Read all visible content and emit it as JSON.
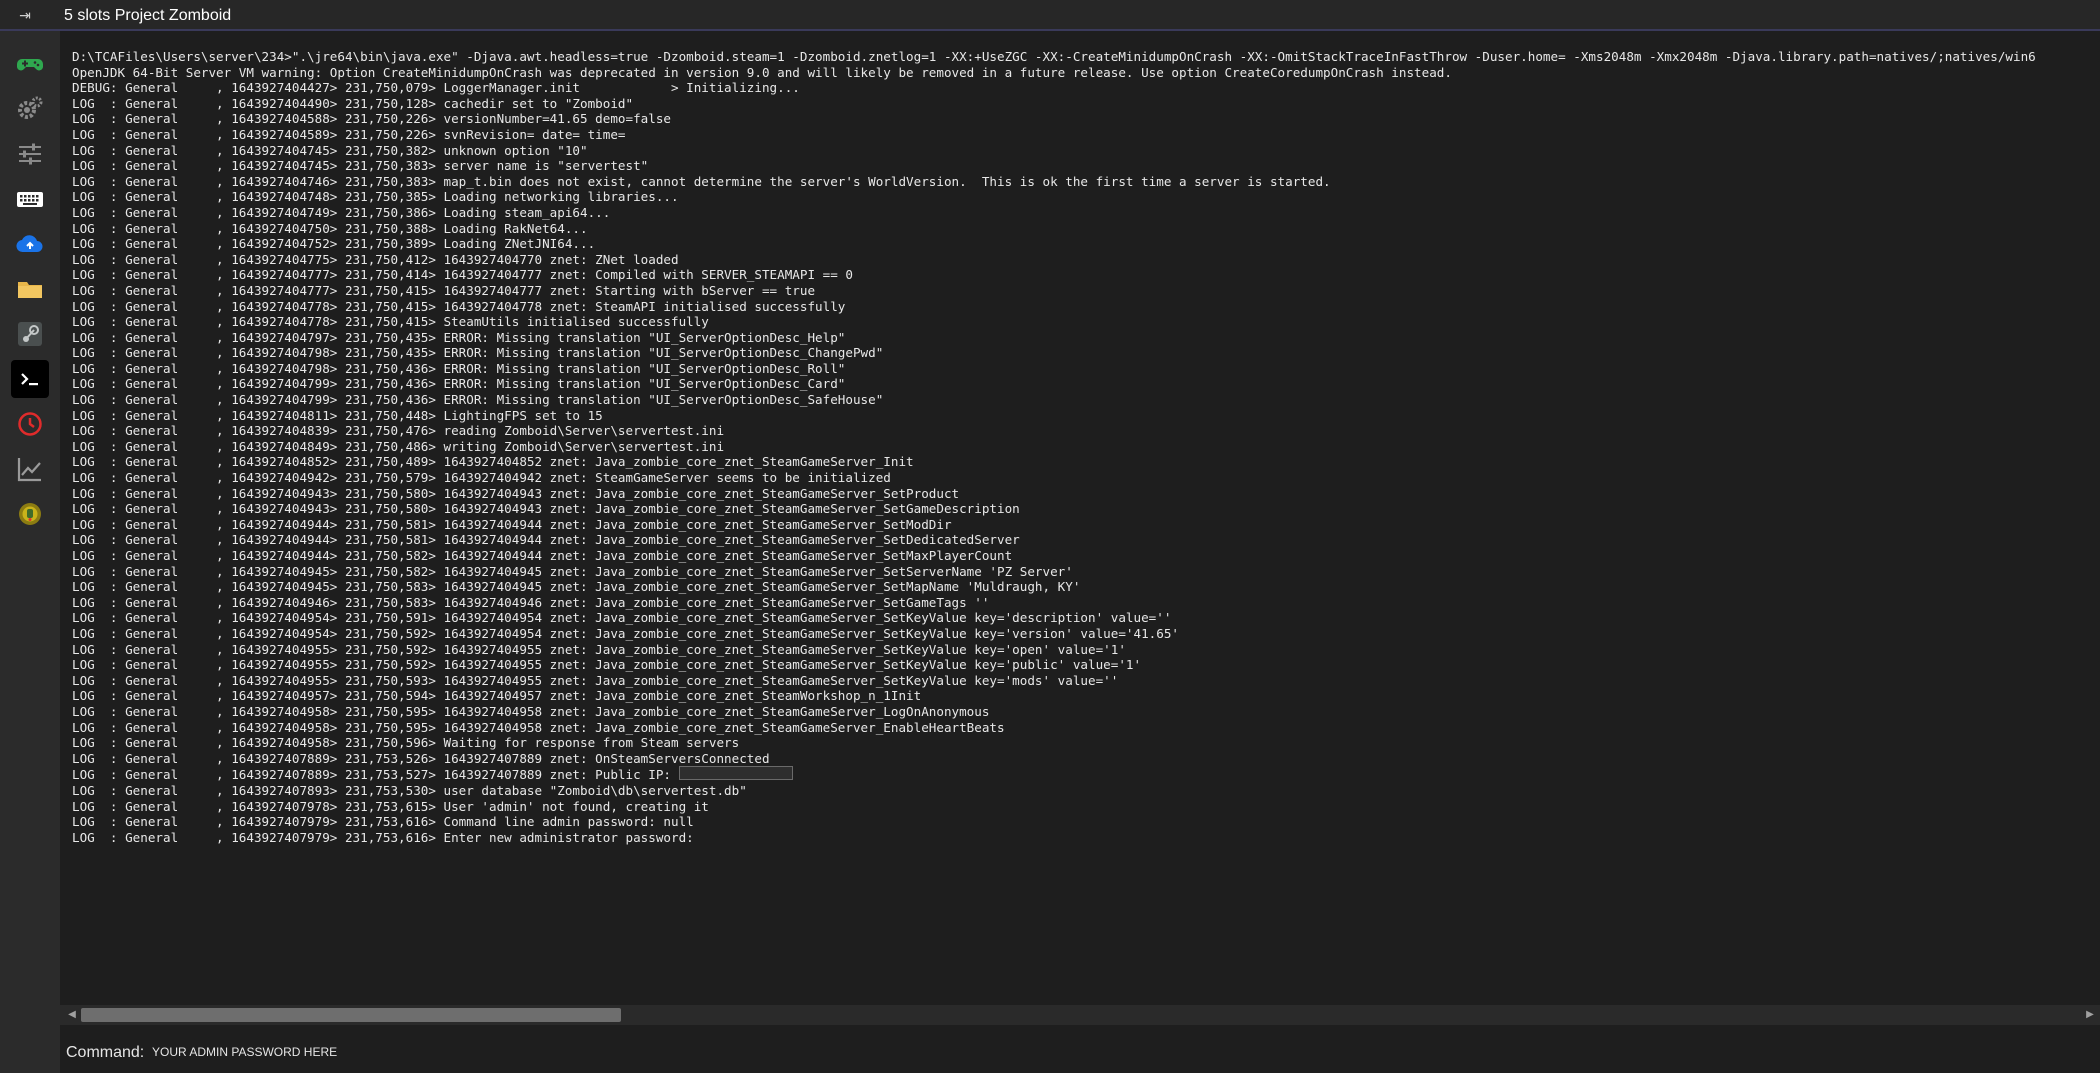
{
  "window": {
    "title": "5 slots Project Zomboid",
    "pin_glyph": "⇥"
  },
  "sidebar": {
    "items": [
      {
        "icon": "gamepad-icon",
        "color": "#2fa84f"
      },
      {
        "icon": "gears-icon",
        "color": "#8a8a8a"
      },
      {
        "icon": "sliders-icon",
        "color": "#8a8a8a"
      },
      {
        "icon": "keyboard-icon",
        "color": "#ffffff"
      },
      {
        "icon": "cloud-upload-icon",
        "color": "#1a73e8"
      },
      {
        "icon": "folder-icon",
        "color": "#e8b64a"
      },
      {
        "icon": "steam-icon",
        "color": "#9aa0a0"
      },
      {
        "icon": "terminal-icon",
        "color": "#ffffff",
        "active": true
      },
      {
        "icon": "clock-icon",
        "color": "#e02b2b"
      },
      {
        "icon": "chart-icon",
        "color": "#9a9a9a"
      },
      {
        "icon": "game-badge-icon",
        "color": "#c9b21a"
      }
    ]
  },
  "console": {
    "lines": [
      "D:\\TCAFiles\\Users\\server\\234>\".\\jre64\\bin\\java.exe\" -Djava.awt.headless=true -Dzomboid.steam=1 -Dzomboid.znetlog=1 -XX:+UseZGC -XX:-CreateMinidumpOnCrash -XX:-OmitStackTraceInFastThrow -Duser.home= -Xms2048m -Xmx2048m -Djava.library.path=natives/;natives/win6",
      "OpenJDK 64-Bit Server VM warning: Option CreateMinidumpOnCrash was deprecated in version 9.0 and will likely be removed in a future release. Use option CreateCoredumpOnCrash instead.",
      "DEBUG: General     , 1643927404427> 231,750,079> LoggerManager.init            > Initializing...",
      "LOG  : General     , 1643927404490> 231,750,128> cachedir set to \"Zomboid\"",
      "LOG  : General     , 1643927404588> 231,750,226> versionNumber=41.65 demo=false",
      "LOG  : General     , 1643927404589> 231,750,226> svnRevision= date= time=",
      "LOG  : General     , 1643927404745> 231,750,382> unknown option \"10\"",
      "LOG  : General     , 1643927404745> 231,750,383> server name is \"servertest\"",
      "LOG  : General     , 1643927404746> 231,750,383> map_t.bin does not exist, cannot determine the server's WorldVersion.  This is ok the first time a server is started.",
      "LOG  : General     , 1643927404748> 231,750,385> Loading networking libraries...",
      "LOG  : General     , 1643927404749> 231,750,386> Loading steam_api64...",
      "LOG  : General     , 1643927404750> 231,750,388> Loading RakNet64...",
      "LOG  : General     , 1643927404752> 231,750,389> Loading ZNetJNI64...",
      "LOG  : General     , 1643927404775> 231,750,412> 1643927404770 znet: ZNet loaded",
      "LOG  : General     , 1643927404777> 231,750,414> 1643927404777 znet: Compiled with SERVER_STEAMAPI == 0",
      "LOG  : General     , 1643927404777> 231,750,415> 1643927404777 znet: Starting with bServer == true",
      "LOG  : General     , 1643927404778> 231,750,415> 1643927404778 znet: SteamAPI initialised successfully",
      "LOG  : General     , 1643927404778> 231,750,415> SteamUtils initialised successfully",
      "LOG  : General     , 1643927404797> 231,750,435> ERROR: Missing translation \"UI_ServerOptionDesc_Help\"",
      "LOG  : General     , 1643927404798> 231,750,435> ERROR: Missing translation \"UI_ServerOptionDesc_ChangePwd\"",
      "LOG  : General     , 1643927404798> 231,750,436> ERROR: Missing translation \"UI_ServerOptionDesc_Roll\"",
      "LOG  : General     , 1643927404799> 231,750,436> ERROR: Missing translation \"UI_ServerOptionDesc_Card\"",
      "LOG  : General     , 1643927404799> 231,750,436> ERROR: Missing translation \"UI_ServerOptionDesc_SafeHouse\"",
      "LOG  : General     , 1643927404811> 231,750,448> LightingFPS set to 15",
      "LOG  : General     , 1643927404839> 231,750,476> reading Zomboid\\Server\\servertest.ini",
      "LOG  : General     , 1643927404849> 231,750,486> writing Zomboid\\Server\\servertest.ini",
      "LOG  : General     , 1643927404852> 231,750,489> 1643927404852 znet: Java_zombie_core_znet_SteamGameServer_Init",
      "LOG  : General     , 1643927404942> 231,750,579> 1643927404942 znet: SteamGameServer seems to be initialized",
      "LOG  : General     , 1643927404943> 231,750,580> 1643927404943 znet: Java_zombie_core_znet_SteamGameServer_SetProduct",
      "LOG  : General     , 1643927404943> 231,750,580> 1643927404943 znet: Java_zombie_core_znet_SteamGameServer_SetGameDescription",
      "LOG  : General     , 1643927404944> 231,750,581> 1643927404944 znet: Java_zombie_core_znet_SteamGameServer_SetModDir",
      "LOG  : General     , 1643927404944> 231,750,581> 1643927404944 znet: Java_zombie_core_znet_SteamGameServer_SetDedicatedServer",
      "LOG  : General     , 1643927404944> 231,750,582> 1643927404944 znet: Java_zombie_core_znet_SteamGameServer_SetMaxPlayerCount",
      "LOG  : General     , 1643927404945> 231,750,582> 1643927404945 znet: Java_zombie_core_znet_SteamGameServer_SetServerName 'PZ Server'",
      "LOG  : General     , 1643927404945> 231,750,583> 1643927404945 znet: Java_zombie_core_znet_SteamGameServer_SetMapName 'Muldraugh, KY'",
      "LOG  : General     , 1643927404946> 231,750,583> 1643927404946 znet: Java_zombie_core_znet_SteamGameServer_SetGameTags ''",
      "LOG  : General     , 1643927404954> 231,750,591> 1643927404954 znet: Java_zombie_core_znet_SteamGameServer_SetKeyValue key='description' value=''",
      "LOG  : General     , 1643927404954> 231,750,592> 1643927404954 znet: Java_zombie_core_znet_SteamGameServer_SetKeyValue key='version' value='41.65'",
      "LOG  : General     , 1643927404955> 231,750,592> 1643927404955 znet: Java_zombie_core_znet_SteamGameServer_SetKeyValue key='open' value='1'",
      "LOG  : General     , 1643927404955> 231,750,592> 1643927404955 znet: Java_zombie_core_znet_SteamGameServer_SetKeyValue key='public' value='1'",
      "LOG  : General     , 1643927404955> 231,750,593> 1643927404955 znet: Java_zombie_core_znet_SteamGameServer_SetKeyValue key='mods' value=''",
      "LOG  : General     , 1643927404957> 231,750,594> 1643927404957 znet: Java_zombie_core_znet_SteamWorkshop_n_1Init",
      "LOG  : General     , 1643927404958> 231,750,595> 1643927404958 znet: Java_zombie_core_znet_SteamGameServer_LogOnAnonymous",
      "LOG  : General     , 1643927404958> 231,750,595> 1643927404958 znet: Java_zombie_core_znet_SteamGameServer_EnableHeartBeats",
      "LOG  : General     , 1643927404958> 231,750,596> Waiting for response from Steam servers",
      "LOG  : General     , 1643927407889> 231,753,526> 1643927407889 znet: OnSteamServersConnected",
      "LOG  : General     , 1643927407889> 231,753,527> 1643927407889 znet: Public IP: ",
      "LOG  : General     , 1643927407893> 231,753,530> user database \"Zomboid\\db\\servertest.db\"",
      "LOG  : General     , 1643927407978> 231,753,615> User 'admin' not found, creating it",
      "LOG  : General     , 1643927407979> 231,753,616> Command line admin password: null",
      "LOG  : General     , 1643927407979> 231,753,616> Enter new administrator password:"
    ],
    "redacted_line_index": 46
  },
  "scrollbar": {
    "left_arrow": "◀",
    "right_arrow": "▶",
    "position_fraction": 0.27
  },
  "command": {
    "label": "Command:",
    "value": "YOUR ADMIN PASSWORD HERE"
  }
}
